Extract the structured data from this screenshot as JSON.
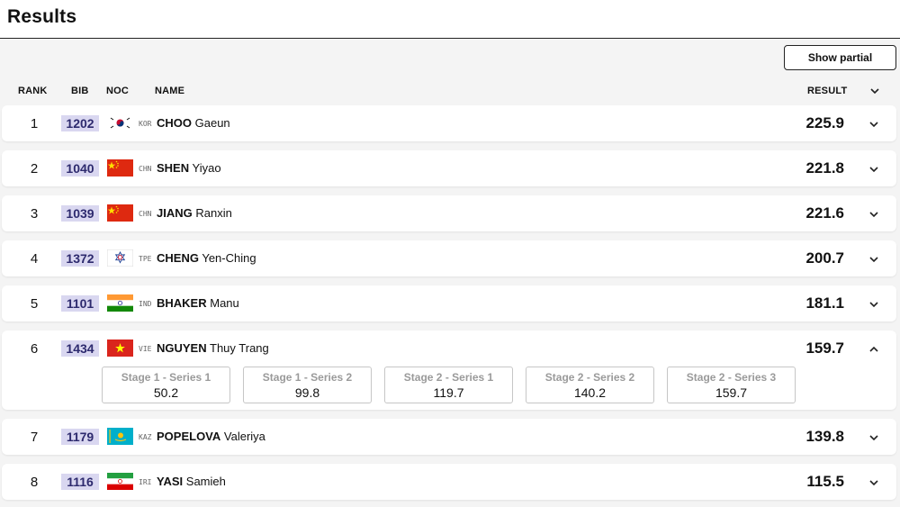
{
  "page": {
    "title": "Results",
    "show_partial_label": "Show partial"
  },
  "columns": {
    "rank": "RANK",
    "bib": "BIB",
    "noc": "NOC",
    "name": "NAME",
    "result": "RESULT"
  },
  "icons": {
    "expand": "chevron-down-icon",
    "collapse": "chevron-up-icon"
  },
  "rows": [
    {
      "rank": "1",
      "bib": "1202",
      "noc": "KOR",
      "surname": "CHOO",
      "given": "Gaeun",
      "result": "225.9",
      "flag": "flag-kor-icon",
      "expanded": false
    },
    {
      "rank": "2",
      "bib": "1040",
      "noc": "CHN",
      "surname": "SHEN",
      "given": "Yiyao",
      "result": "221.8",
      "flag": "flag-chn-icon",
      "expanded": false
    },
    {
      "rank": "3",
      "bib": "1039",
      "noc": "CHN",
      "surname": "JIANG",
      "given": "Ranxin",
      "result": "221.6",
      "flag": "flag-chn-icon",
      "expanded": false
    },
    {
      "rank": "4",
      "bib": "1372",
      "noc": "TPE",
      "surname": "CHENG",
      "given": "Yen-Ching",
      "result": "200.7",
      "flag": "flag-tpe-icon",
      "expanded": false
    },
    {
      "rank": "5",
      "bib": "1101",
      "noc": "IND",
      "surname": "BHAKER",
      "given": "Manu",
      "result": "181.1",
      "flag": "flag-ind-icon",
      "expanded": false
    },
    {
      "rank": "6",
      "bib": "1434",
      "noc": "VIE",
      "surname": "NGUYEN",
      "given": "Thuy Trang",
      "result": "159.7",
      "flag": "flag-vie-icon",
      "expanded": true,
      "stages": [
        {
          "label": "Stage 1 - Series 1",
          "value": "50.2"
        },
        {
          "label": "Stage 1 - Series 2",
          "value": "99.8"
        },
        {
          "label": "Stage 2 - Series 1",
          "value": "119.7"
        },
        {
          "label": "Stage 2 - Series 2",
          "value": "140.2"
        },
        {
          "label": "Stage 2 - Series 3",
          "value": "159.7"
        }
      ]
    },
    {
      "rank": "7",
      "bib": "1179",
      "noc": "KAZ",
      "surname": "POPELOVA",
      "given": "Valeriya",
      "result": "139.8",
      "flag": "flag-kaz-icon",
      "expanded": false
    },
    {
      "rank": "8",
      "bib": "1116",
      "noc": "IRI",
      "surname": "YASI",
      "given": "Samieh",
      "result": "115.5",
      "flag": "flag-iri-icon",
      "expanded": false
    }
  ]
}
